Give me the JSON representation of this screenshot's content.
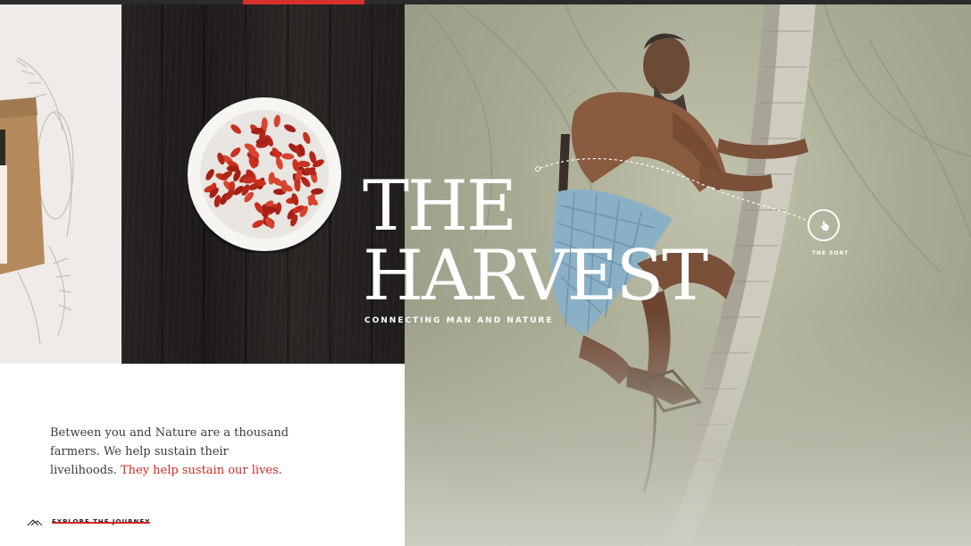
{
  "hero": {
    "title_line1": "THE",
    "title_line2": "HARVEST",
    "subtitle": "CONNECTING MAN AND NATURE",
    "hotspot_label": "THE SORT",
    "hotspot_icon": "hand-pointer-icon"
  },
  "intro": {
    "line_text": "Between you and Nature are a thousand farmers. We help sustain their livelihoods.",
    "highlight": "They help sustain our lives."
  },
  "cta": {
    "explore_label": "EXPLORE THE JOURNEY",
    "icon": "mountain-icon"
  },
  "panels": {
    "product": "product-bag-image",
    "bowl": "goji-berries-bowl-image",
    "photo": "coconut-tree-climber-image"
  },
  "colors": {
    "accent": "#d8302c",
    "highlight_text": "#cc2a22",
    "topbar": "#2b2b2b",
    "hero_bg": "#a8ab94"
  }
}
